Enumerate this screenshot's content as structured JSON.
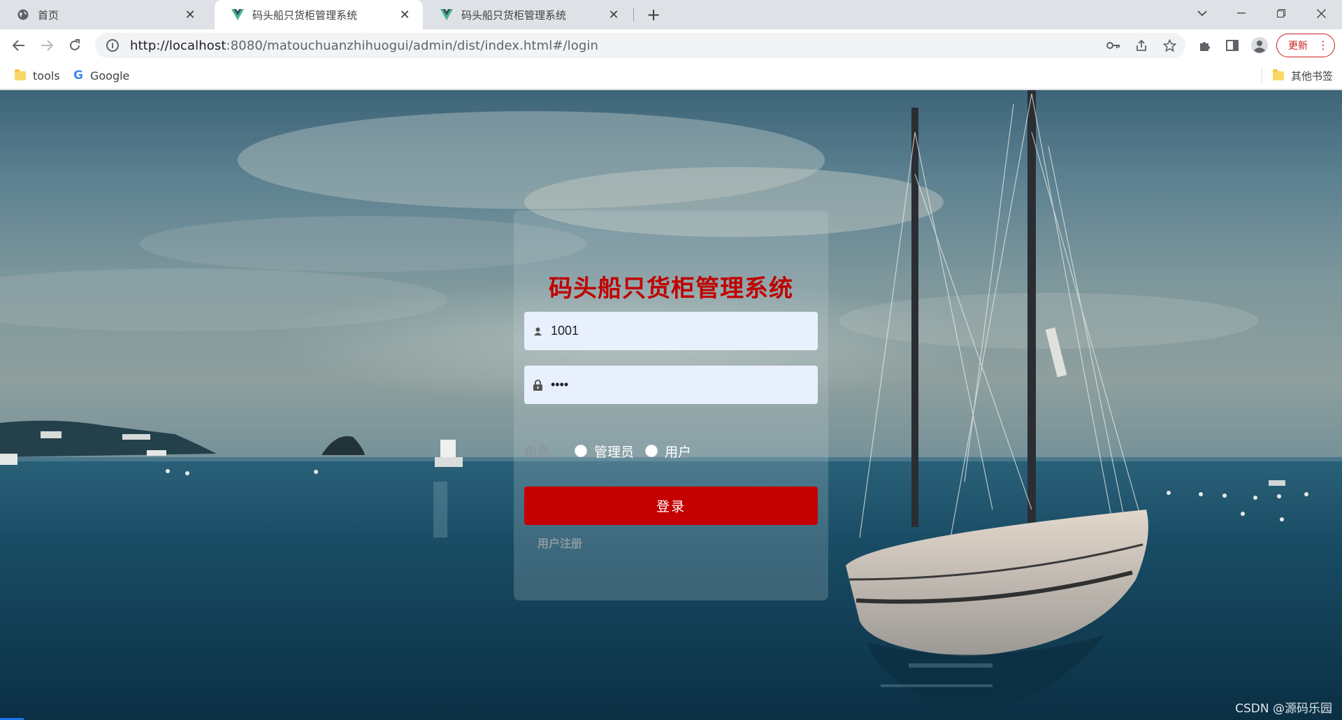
{
  "browser": {
    "tabs": [
      {
        "title": "首页",
        "active": false
      },
      {
        "title": "码头船只货柜管理系统",
        "active": true
      },
      {
        "title": "码头船只货柜管理系统",
        "active": false
      }
    ],
    "url_host": "http://localhost",
    "url_rest": ":8080/matouchuanzhihuogui/admin/dist/index.html#/login",
    "update_label": "更新",
    "bookmarks": [
      {
        "label": "tools",
        "icon": "folder-icon"
      },
      {
        "label": "Google",
        "icon": "google-icon"
      }
    ],
    "other_bookmarks": "其他书签"
  },
  "login": {
    "title": "码头船只货柜管理系统",
    "username_value": "1001",
    "password_value": "••••",
    "role_label": "角色",
    "role_options": [
      "管理员",
      "用户"
    ],
    "submit_label": "登录",
    "register_label": "用户注册"
  },
  "watermark": "CSDN @源码乐园",
  "colors": {
    "accent": "#c40000",
    "title": "#c00000",
    "input_bg": "#e8f0fe"
  }
}
